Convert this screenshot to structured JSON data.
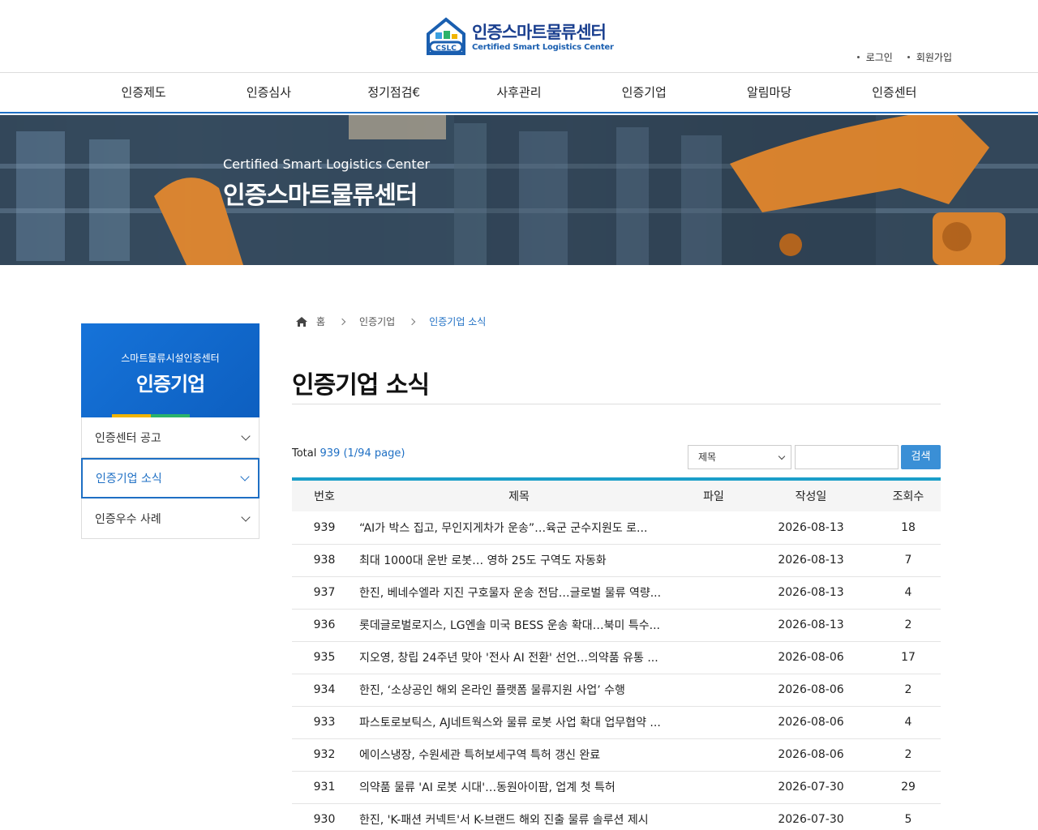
{
  "header": {
    "logo_ko": "인증스마트물류센터",
    "logo_en": "Certified Smart Logistics Center",
    "logo_badge": "CSLC",
    "login": "로그인",
    "signup": "회원가입"
  },
  "gnb": [
    "인증제도",
    "인증심사",
    "정기점검€",
    "사후관리",
    "인증기업",
    "알림마당",
    "인증센터"
  ],
  "banner": {
    "en": "Certified Smart Logistics Center",
    "ko": "인증스마트물류센터"
  },
  "sidebar": {
    "sub": "스마트물류시설인증센터",
    "title": "인증기업",
    "items": [
      "인증센터 공고",
      "인증기업 소식",
      "인증우수 사례"
    ]
  },
  "breadcrumb": {
    "home": "홈",
    "level1": "인증기업",
    "current": "인증기업 소식"
  },
  "page_title": "인증기업 소식",
  "list": {
    "total_label": "Total",
    "total_value": "939 (1/94 page)",
    "search_option": "제목",
    "search_button": "검색",
    "columns": [
      "번호",
      "제목",
      "파일",
      "작성일",
      "조회수"
    ],
    "rows": [
      {
        "num": "939",
        "subject": "“AI가 박스 집고, 무인지게차가 운송”…육군 군수지원도 로...",
        "file": "",
        "date": "2026-08-13",
        "views": "18"
      },
      {
        "num": "938",
        "subject": "최대 1000대 운반 로봇… 영하 25도 구역도 자동화",
        "file": "",
        "date": "2026-08-13",
        "views": "7"
      },
      {
        "num": "937",
        "subject": "한진, 베네수엘라 지진 구호물자 운송 전담…글로벌 물류 역량...",
        "file": "",
        "date": "2026-08-13",
        "views": "4"
      },
      {
        "num": "936",
        "subject": "롯데글로벌로지스, LG엔솔 미국 BESS 운송 확대…북미 특수...",
        "file": "",
        "date": "2026-08-13",
        "views": "2"
      },
      {
        "num": "935",
        "subject": "지오영, 창립 24주년 맞아 '전사 AI 전환' 선언…의약품 유통 ...",
        "file": "",
        "date": "2026-08-06",
        "views": "17"
      },
      {
        "num": "934",
        "subject": "한진, ‘소상공인 해외 온라인 플랫폼 물류지원 사업’ 수행",
        "file": "",
        "date": "2026-08-06",
        "views": "2"
      },
      {
        "num": "933",
        "subject": "파스토로보틱스, AJ네트웍스와 물류 로봇 사업 확대 업무협약 ...",
        "file": "",
        "date": "2026-08-06",
        "views": "4"
      },
      {
        "num": "932",
        "subject": "에이스냉장, 수원세관 특허보세구역 특허 갱신 완료",
        "file": "",
        "date": "2026-08-06",
        "views": "2"
      },
      {
        "num": "931",
        "subject": "의약품 물류 'AI 로봇 시대'…동원아이팜, 업계 첫 특허",
        "file": "",
        "date": "2026-07-30",
        "views": "29"
      },
      {
        "num": "930",
        "subject": "한진, 'K-패션 커넥트'서 K-브랜드 해외 진출 물류 솔루션 제시",
        "file": "",
        "date": "2026-07-30",
        "views": "5"
      }
    ]
  }
}
